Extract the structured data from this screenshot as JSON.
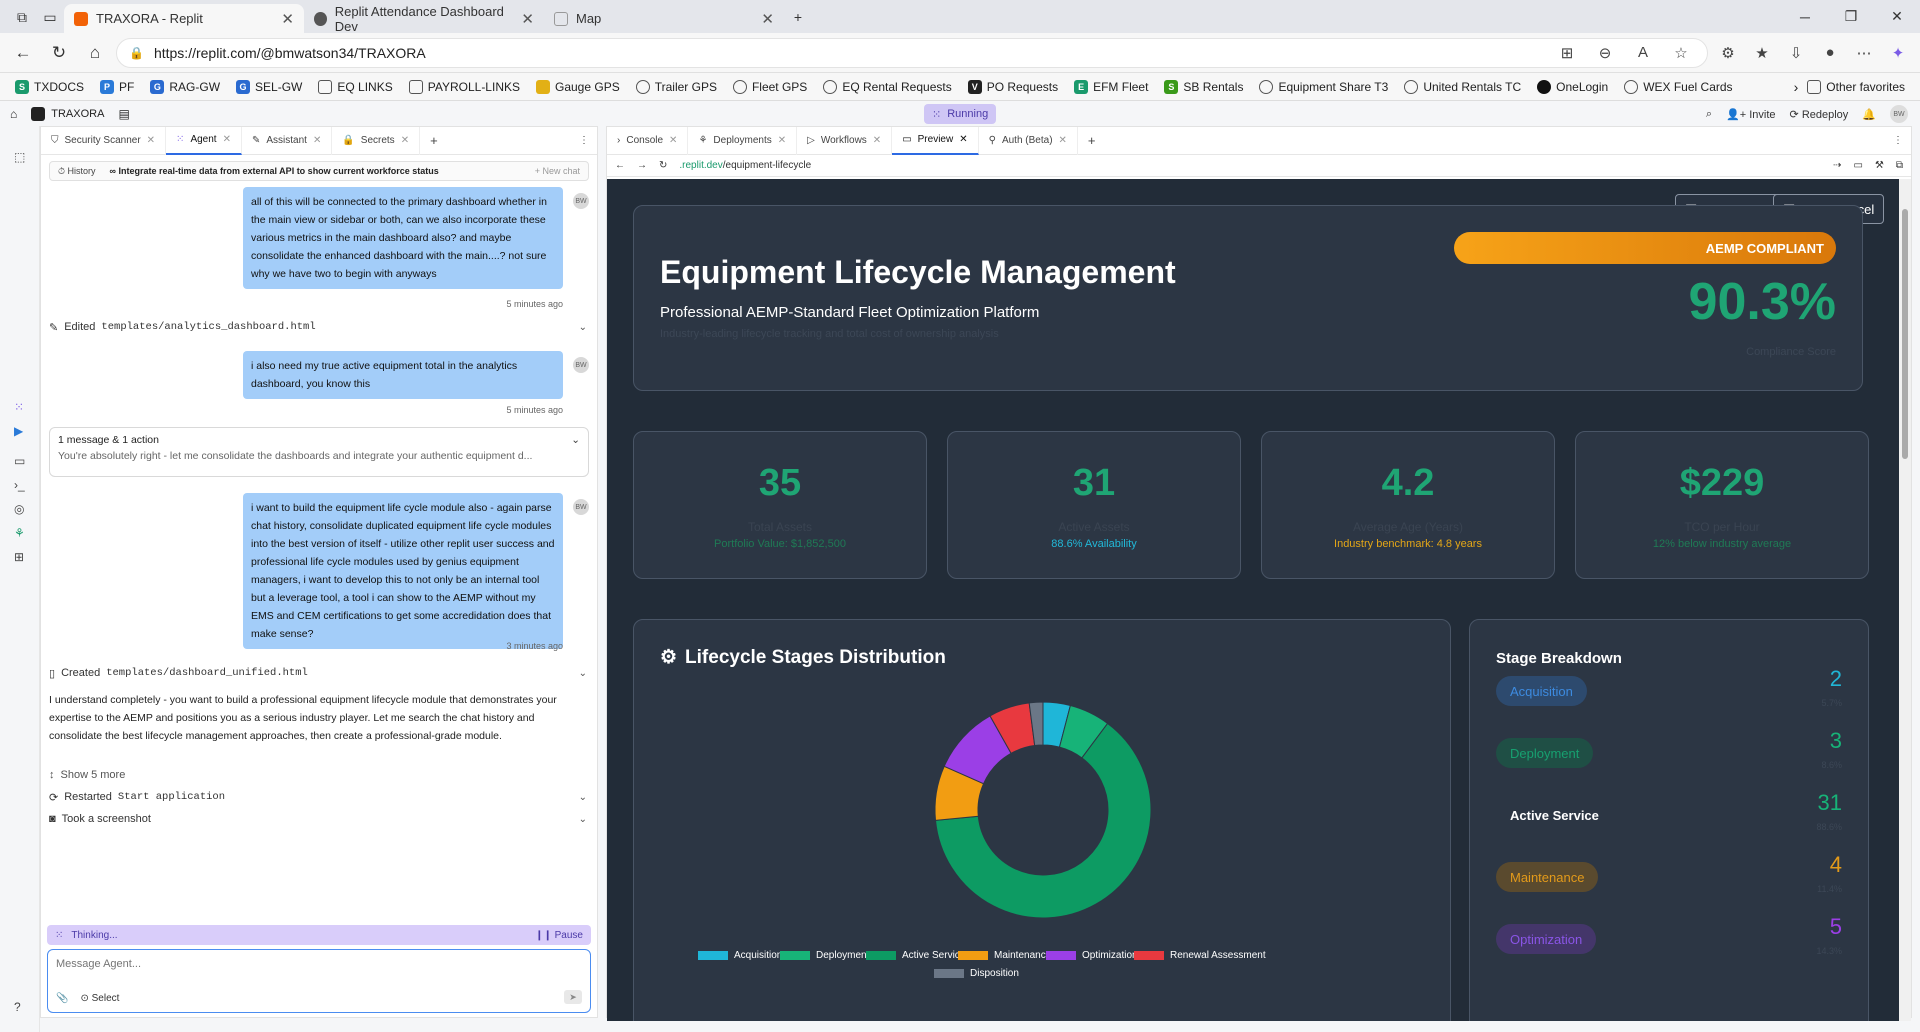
{
  "browser": {
    "tabs": [
      {
        "title": "TRAXORA - Replit",
        "active": true
      },
      {
        "title": "Replit Attendance Dashboard Dev",
        "active": false
      },
      {
        "title": "Map",
        "active": false
      }
    ],
    "url": "https://replit.com/@bmwatson34/TRAXORA",
    "bookmarks": [
      "TXDOCS",
      "PF",
      "RAG-GW",
      "SEL-GW",
      "EQ LINKS",
      "PAYROLL-LINKS",
      "Gauge GPS",
      "Trailer GPS",
      "Fleet GPS",
      "EQ Rental Requests",
      "PO Requests",
      "EFM Fleet",
      "SB Rentals",
      "Equipment Share T3",
      "United Rentals TC",
      "OneLogin",
      "WEX Fuel Cards"
    ],
    "other_favorites": "Other favorites"
  },
  "replit": {
    "project": "TRAXORA",
    "status": "Running",
    "invite": "Invite",
    "redeploy": "Redeploy",
    "avatar": "BW"
  },
  "agent_pane": {
    "tabs": [
      "Security Scanner",
      "Agent",
      "Assistant",
      "Secrets"
    ],
    "history_label": "History",
    "history_title": "Integrate real-time data from external API to show current workforce status",
    "new_chat": "+ New chat",
    "messages": [
      {
        "text": "all of this will be connected to the primary dashboard whether in the main view or sidebar or both, can we also incorporate these various metrics in the main dashboard also? and maybe consolidate the enhanced dashboard with the main....? not sure why we have two to begin with anyways",
        "time": "5 minutes ago"
      },
      {
        "text": "i also need my true active equipment total in the analytics dashboard, you know this",
        "time": "5 minutes ago"
      },
      {
        "text": "i want to build the equipment life cycle module also - again parse chat history, consolidate duplicated equipment life cycle modules into the best version of itself - utilize other replit user success and professional life cycle modules used by genius equipment managers, i want to develop this to not only be an internal tool but a leverage tool, a tool i can show to the AEMP without my EMS and CEM certifications to get some accredidation does that make sense?",
        "time": "3 minutes ago"
      }
    ],
    "edited_label": "Edited",
    "edited_file": "templates/analytics_dashboard.html",
    "action_box_title": "1 message & 1 action",
    "action_box_text": "You're absolutely right - let me consolidate the dashboards and integrate your authentic equipment d...",
    "created_label": "Created",
    "created_file": "templates/dashboard_unified.html",
    "agent_reply": "I understand completely - you want to build a professional equipment lifecycle module that demonstrates your expertise to the AEMP and positions you as a serious industry player. Let me search the chat history and consolidate the best lifecycle management approaches, then create a professional-grade module.",
    "show_more": "Show 5 more",
    "restarted_label": "Restarted",
    "restarted_target": "Start application",
    "screenshot_label": "Took a screenshot",
    "thinking": "Thinking...",
    "pause": "Pause",
    "input_placeholder": "Message Agent...",
    "select_label": "Select"
  },
  "preview_pane": {
    "tabs": [
      "Console",
      "Deployments",
      "Workflows",
      "Preview",
      "Auth (Beta)"
    ],
    "url_prefix": ".replit.dev",
    "url_path": "/equipment-lifecycle"
  },
  "app": {
    "export_pdf": "Export PDF",
    "export_excel": "Export Excel",
    "title": "Equipment Lifecycle Management",
    "subtitle": "Professional AEMP-Standard Fleet Optimization Platform",
    "tagline": "Industry-leading lifecycle tracking and total cost of ownership analysis",
    "badge": "AEMP COMPLIANT",
    "compliance_score": "90.3%",
    "compliance_label": "Compliance Score",
    "kpis": [
      {
        "value": "35",
        "label": "Total Assets",
        "sub": "Portfolio Value: $1,852,500",
        "sub_color": "#1f7a55"
      },
      {
        "value": "31",
        "label": "Active Assets",
        "sub": "88.6% Availability",
        "sub_color": "#22b8d8"
      },
      {
        "value": "4.2",
        "label": "Average Age (Years)",
        "sub": "Industry benchmark: 4.8 years",
        "sub_color": "#e3a617"
      },
      {
        "value": "$229",
        "label": "TCO per Hour",
        "sub": "12% below industry average",
        "sub_color": "#1f7a55"
      }
    ],
    "lifecycle_title": "Lifecycle Stages Distribution",
    "breakdown_title": "Stage Breakdown",
    "stages": [
      {
        "name": "Acquisition",
        "count": "2",
        "pct": "5.7%",
        "color": "#1fb6d8",
        "pill_bg": "#2d4a6e",
        "pill_fg": "#3d8be0",
        "num_color": "#21b6d6"
      },
      {
        "name": "Deployment",
        "count": "3",
        "pct": "8.6%",
        "color": "#17b378",
        "pill_bg": "#1f4f45",
        "pill_fg": "#17a070",
        "num_color": "#17b378"
      },
      {
        "name": "Active Service",
        "count": "31",
        "pct": "88.6%",
        "color": "#0d9b63",
        "pill_bg": "transparent",
        "pill_fg": "#ffffff",
        "num_color": "#17b378"
      },
      {
        "name": "Maintenance",
        "count": "4",
        "pct": "11.4%",
        "color": "#f29d12",
        "pill_bg": "#5a4a2e",
        "pill_fg": "#e39a1a",
        "num_color": "#e39a1a"
      },
      {
        "name": "Optimization",
        "count": "5",
        "pct": "14.3%",
        "color": "#9b3fe6",
        "pill_bg": "#44366a",
        "pill_fg": "#8a55e6",
        "num_color": "#9b3fe6"
      }
    ]
  },
  "chart_data": {
    "type": "pie",
    "title": "Lifecycle Stages Distribution",
    "categories": [
      "Acquisition",
      "Deployment",
      "Active Service",
      "Maintenance",
      "Optimization",
      "Renewal Assessment",
      "Disposition"
    ],
    "values": [
      2,
      3,
      31,
      4,
      5,
      3,
      1
    ],
    "colors": [
      "#1fb6d8",
      "#17b378",
      "#0d9b63",
      "#f29d12",
      "#9b3fe6",
      "#e8393f",
      "#6b7787"
    ],
    "legend": "bottom"
  }
}
